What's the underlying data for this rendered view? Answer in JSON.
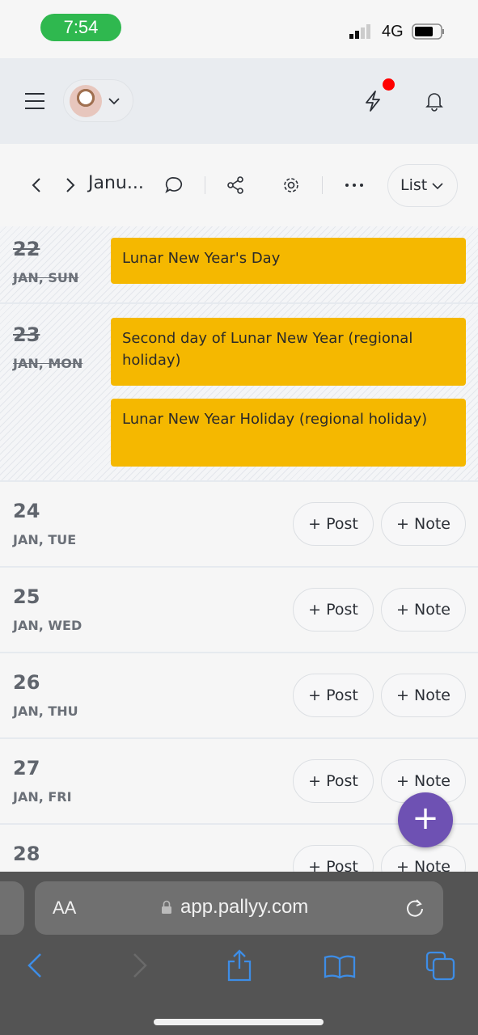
{
  "status_bar": {
    "time": "7:54",
    "network": "4G"
  },
  "header": {
    "notification_dot_color": "#ff0000"
  },
  "toolbar": {
    "title": "Janu...",
    "view_label": "List"
  },
  "days": [
    {
      "num": "22",
      "label": "JAN, SUN",
      "past": true,
      "events": [
        "Lunar New Year's Day"
      ]
    },
    {
      "num": "23",
      "label": "JAN, MON",
      "past": true,
      "events": [
        "Second day of Lunar New Year (regional holiday)",
        "Lunar New Year Holiday (regional holiday)"
      ]
    },
    {
      "num": "24",
      "label": "JAN, TUE"
    },
    {
      "num": "25",
      "label": "JAN, WED"
    },
    {
      "num": "26",
      "label": "JAN, THU"
    },
    {
      "num": "27",
      "label": "JAN, FRI"
    },
    {
      "num": "28",
      "label": ""
    }
  ],
  "actions": {
    "post": "+ Post",
    "note": "+ Note",
    "fab": "+"
  },
  "browser": {
    "aa": "AA",
    "url": "app.pallyy.com"
  },
  "colors": {
    "event": "#f5b800",
    "fab": "#6e51b3",
    "status_pill": "#2fb84f",
    "browser_accent": "#3d8de6"
  }
}
